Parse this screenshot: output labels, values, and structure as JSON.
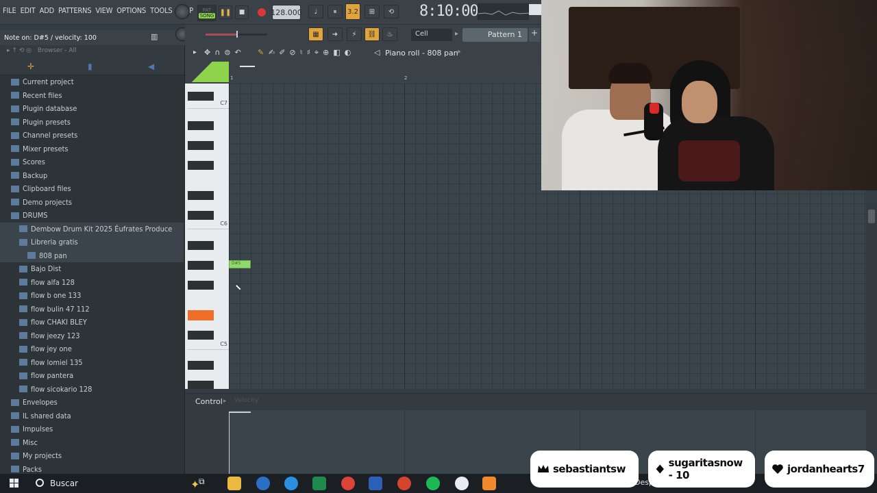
{
  "menubar": {
    "items": [
      "FILE",
      "EDIT",
      "ADD",
      "PATTERNS",
      "VIEW",
      "OPTIONS",
      "TOOLS",
      "HELP"
    ]
  },
  "transport": {
    "mode_pat": "PAT",
    "mode_song": "SONG",
    "tempo": "128.000",
    "time": "8:10:00",
    "snap": "Cell",
    "pattern": "Pattern 1",
    "pattern_add": "+"
  },
  "hint": "Note on: D#5 / velocity: 100",
  "browser": {
    "header": "Browser - All",
    "items": [
      {
        "label": "Current project",
        "icon": "project-icon",
        "indent": 0
      },
      {
        "label": "Recent files",
        "icon": "recent-icon",
        "indent": 0
      },
      {
        "label": "Plugin database",
        "icon": "plugin-database-icon",
        "indent": 0
      },
      {
        "label": "Plugin presets",
        "icon": "plugin-presets-icon",
        "indent": 0
      },
      {
        "label": "Channel presets",
        "icon": "channel-presets-icon",
        "indent": 0
      },
      {
        "label": "Mixer presets",
        "icon": "mixer-presets-icon",
        "indent": 0
      },
      {
        "label": "Scores",
        "icon": "scores-icon",
        "indent": 0
      },
      {
        "label": "Backup",
        "icon": "backup-icon",
        "indent": 0
      },
      {
        "label": "Clipboard files",
        "icon": "folder-icon",
        "indent": 0
      },
      {
        "label": "Demo projects",
        "icon": "folder-icon",
        "indent": 0
      },
      {
        "label": "DRUMS",
        "icon": "folder-open-icon",
        "indent": 0
      },
      {
        "label": "Dembow Drum Kit 2025 Éufrates Produce",
        "icon": "folder-open-icon",
        "indent": 1
      },
      {
        "label": "Libreria gratis",
        "icon": "folder-open-icon",
        "indent": 1
      },
      {
        "label": "808 pan",
        "icon": "folder-icon",
        "indent": 2
      },
      {
        "label": "Bajo Dist",
        "icon": "folder-icon",
        "indent": 1
      },
      {
        "label": "flow alfa 128",
        "icon": "folder-icon",
        "indent": 1
      },
      {
        "label": "flow b one 133",
        "icon": "folder-icon",
        "indent": 1
      },
      {
        "label": "flow bulin 47 112",
        "icon": "folder-icon",
        "indent": 1
      },
      {
        "label": "flow CHAKI BLEY",
        "icon": "folder-icon",
        "indent": 1
      },
      {
        "label": "flow jeezy 123",
        "icon": "folder-icon",
        "indent": 1
      },
      {
        "label": "flow jey one",
        "icon": "folder-icon",
        "indent": 1
      },
      {
        "label": "flow lomiel 135",
        "icon": "folder-icon",
        "indent": 1
      },
      {
        "label": "flow pantera",
        "icon": "folder-icon",
        "indent": 1
      },
      {
        "label": "flow sicokario 128",
        "icon": "folder-icon",
        "indent": 1
      },
      {
        "label": "Envelopes",
        "icon": "folder-icon",
        "indent": 0
      },
      {
        "label": "IL shared data",
        "icon": "folder-icon",
        "indent": 0
      },
      {
        "label": "Impulses",
        "icon": "folder-icon",
        "indent": 0
      },
      {
        "label": "Misc",
        "icon": "folder-icon",
        "indent": 0
      },
      {
        "label": "My projects",
        "icon": "folder-icon",
        "indent": 0
      },
      {
        "label": "Packs",
        "icon": "folder-icon",
        "indent": 0
      }
    ]
  },
  "piano_roll": {
    "title": "Piano roll - 808 pan",
    "ruler": [
      "1",
      "2"
    ],
    "octave_labels": [
      "C7",
      "C6",
      "C5"
    ],
    "note_label": "D#5",
    "control_label": "Control",
    "control_target": "Velocity"
  },
  "taskbar": {
    "search_label": "Buscar",
    "tray_text": "Desp"
  },
  "badges": [
    {
      "name": "sebastiantsw",
      "icon": "crown-icon"
    },
    {
      "name": "sugaritasnow - 10",
      "icon": "diamond-icon"
    },
    {
      "name": "jordanhearts7",
      "icon": "heart-icon"
    }
  ],
  "colors": {
    "song_mode": "#8fd24b",
    "active_key": "#ee6e2a",
    "note": "#8fd86b",
    "record": "#d43a3a"
  }
}
